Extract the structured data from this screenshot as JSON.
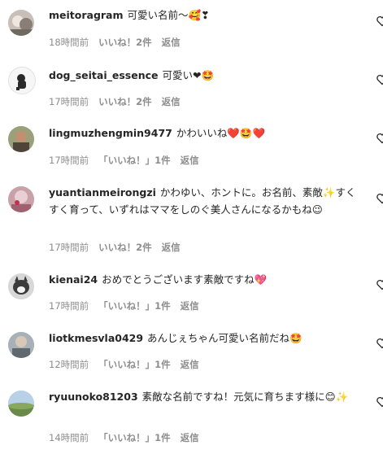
{
  "comments": [
    {
      "username": "meitoragram",
      "text": "可愛い名前〜🥰❣",
      "time": "18時間前",
      "likes": "いいね！2件",
      "reply": "返信"
    },
    {
      "username": "dog_seitai_essence",
      "text": "可愛い❤🤩",
      "time": "17時間前",
      "likes": "いいね！2件",
      "reply": "返信"
    },
    {
      "username": "lingmuzhengmin9477",
      "text": "かわいいね❤️🤩❤️",
      "time": "17時間前",
      "likes": "「いいね！」1件",
      "reply": "返信"
    },
    {
      "username": "yuantianmeirongzi",
      "text": "かわゆい、ホントに。お名前、素敵✨すくすく育って、いずれはママをしのぐ美人さんになるかもね😉",
      "time": "17時間前",
      "likes": "いいね！2件",
      "reply": "返信"
    },
    {
      "username": "kienai24",
      "text": "おめでとうございます素敵ですね💖",
      "time": "17時間前",
      "likes": "「いいね！」1件",
      "reply": "返信"
    },
    {
      "username": "liotkmesvla0429",
      "text": "あんじぇちゃん可愛い名前だね🤩",
      "time": "12時間前",
      "likes": "「いいね！」1件",
      "reply": "返信"
    },
    {
      "username": "ryuunoko81203",
      "text": "素敵な名前ですね！元気に育ちます様に😊✨",
      "time": "14時間前",
      "likes": "「いいね！」1件",
      "reply": "返信"
    }
  ],
  "icons": {
    "like": "heart-outline-icon"
  }
}
